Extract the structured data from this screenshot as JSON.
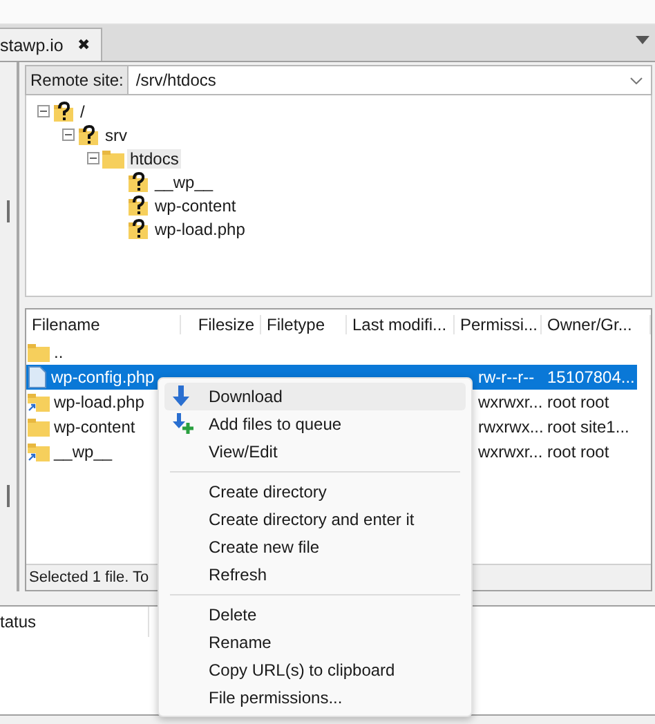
{
  "tab": {
    "title": "stawp.io",
    "close": "✖"
  },
  "remote_site": {
    "label": "Remote site:",
    "value": "/srv/htdocs"
  },
  "tree": [
    {
      "name": "/",
      "kind": "unknown",
      "expanded": true,
      "children": [
        {
          "name": "srv",
          "kind": "unknown",
          "expanded": true,
          "children": [
            {
              "name": "htdocs",
              "kind": "folder",
              "expanded": true,
              "selected": true,
              "children": [
                {
                  "name": "__wp__",
                  "kind": "unknown",
                  "selected": false
                },
                {
                  "name": "wp-content",
                  "kind": "unknown",
                  "selected": false
                },
                {
                  "name": "wp-load.php",
                  "kind": "unknown",
                  "selected": false
                }
              ]
            }
          ]
        }
      ]
    }
  ],
  "file_list": {
    "columns": [
      "Filename",
      "Filesize",
      "Filetype",
      "Last modifi...",
      "Permissi...",
      "Owner/Gr..."
    ],
    "rows": [
      {
        "kind": "folder",
        "name": "..",
        "permissions": "",
        "owner": "",
        "selected": false
      },
      {
        "kind": "file",
        "name": "wp-config.php",
        "permissions": "rw-r--r--",
        "owner": "15107804...",
        "selected": true
      },
      {
        "kind": "link",
        "name": "wp-load.php",
        "permissions": "wxrwxr...",
        "owner": "root root",
        "selected": false
      },
      {
        "kind": "folder",
        "name": "wp-content",
        "permissions": "rwxrwx...",
        "owner": "root site1...",
        "selected": false
      },
      {
        "kind": "link",
        "name": "__wp__",
        "permissions": "wxrwxr...",
        "owner": "root root",
        "selected": false
      }
    ],
    "status": "Selected 1 file. To"
  },
  "queue": {
    "column": "tatus"
  },
  "context_menu": [
    {
      "kind": "item",
      "label": "Download",
      "selected": true
    },
    {
      "kind": "item",
      "label": "Add files to queue",
      "selected": false
    },
    {
      "kind": "item",
      "label": "View/Edit",
      "selected": false
    },
    {
      "kind": "separator"
    },
    {
      "kind": "item",
      "label": "Create directory",
      "selected": false
    },
    {
      "kind": "item",
      "label": "Create directory and enter it",
      "selected": false
    },
    {
      "kind": "item",
      "label": "Create new file",
      "selected": false
    },
    {
      "kind": "item",
      "label": "Refresh",
      "selected": false
    },
    {
      "kind": "separator"
    },
    {
      "kind": "item",
      "label": "Delete",
      "selected": false
    },
    {
      "kind": "item",
      "label": "Rename",
      "selected": false
    },
    {
      "kind": "item",
      "label": "Copy URL(s) to clipboard",
      "selected": false
    },
    {
      "kind": "item",
      "label": "File permissions...",
      "selected": false
    }
  ]
}
